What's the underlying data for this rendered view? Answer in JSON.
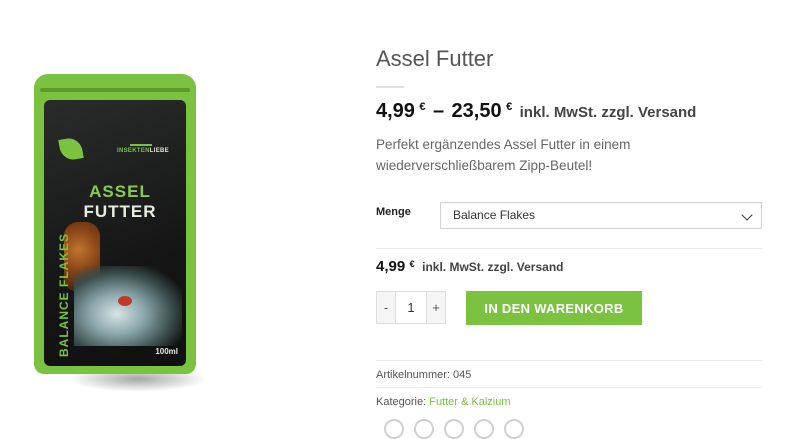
{
  "product": {
    "title": "Assel Futter",
    "price_min": "4,99",
    "price_max": "23,50",
    "currency": "€",
    "tax_note": "inkl. MwSt. zzgl. Versand",
    "description": "Perfekt ergänzendes Assel Futter in einem wiederverschließbarem Zipp-Beutel!",
    "package": {
      "brand_part1": "INSEKTEN",
      "brand_part2": "LIEBE",
      "title_line1": "ASSEL",
      "title_line2": "FUTTER",
      "side_text": "BALANCE FLAKES",
      "volume": "100ml"
    }
  },
  "variation": {
    "label": "Menge",
    "selected": "Balance Flakes"
  },
  "variant_price": {
    "amount": "4,99",
    "currency": "€",
    "tax_note": "inkl. MwSt. zzgl. Versand"
  },
  "cart": {
    "minus": "-",
    "quantity": "1",
    "plus": "+",
    "add_label": "IN DEN WARENKORB"
  },
  "meta": {
    "sku_label": "Artikelnummer:",
    "sku": "045",
    "category_label": "Kategorie:",
    "category": "Futter & Kalzium"
  },
  "colors": {
    "accent": "#7cc241"
  }
}
